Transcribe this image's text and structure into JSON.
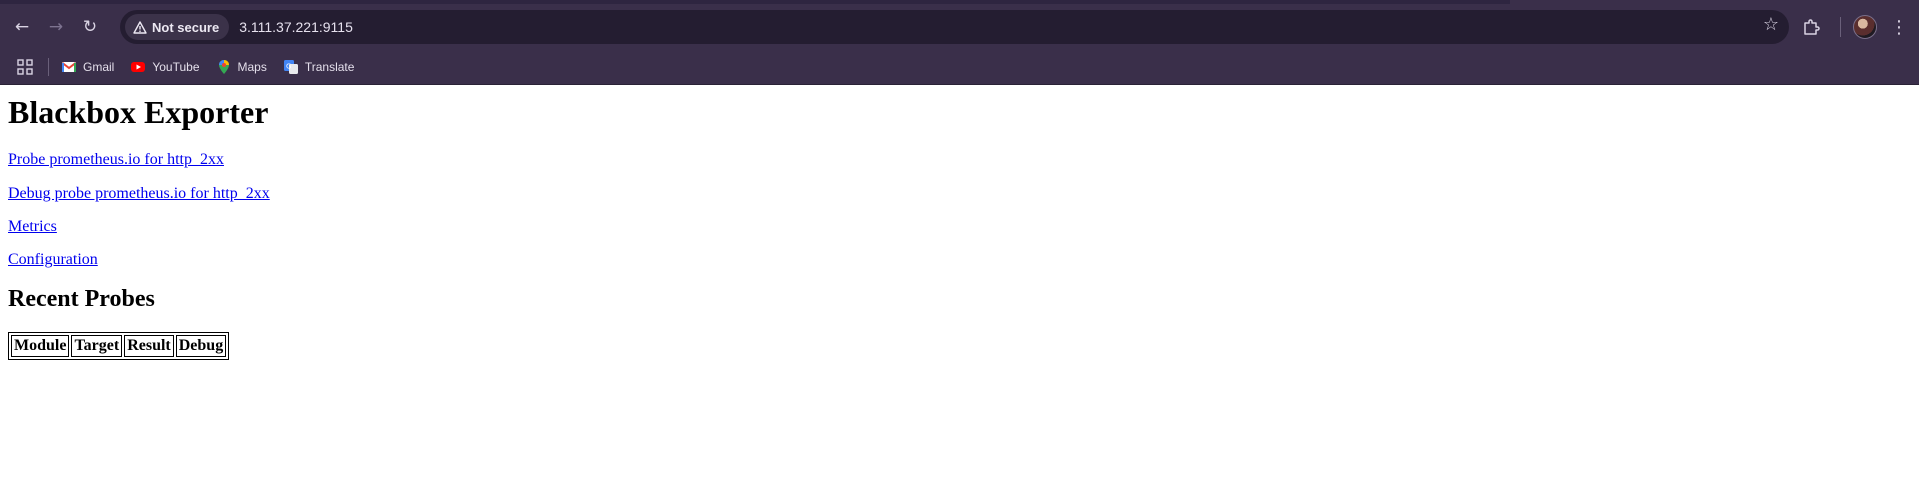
{
  "browser": {
    "url": "3.111.37.221:9115",
    "security_label": "Not secure",
    "bookmarks": [
      {
        "label": "Gmail",
        "icon": "gmail-icon"
      },
      {
        "label": "YouTube",
        "icon": "youtube-icon"
      },
      {
        "label": "Maps",
        "icon": "maps-icon"
      },
      {
        "label": "Translate",
        "icon": "translate-icon"
      }
    ]
  },
  "page": {
    "title": "Blackbox Exporter",
    "links": [
      "Probe prometheus.io for http_2xx",
      "Debug probe prometheus.io for http_2xx",
      "Metrics",
      "Configuration"
    ],
    "recent_heading": "Recent Probes",
    "table_headers": [
      "Module",
      "Target",
      "Result",
      "Debug"
    ]
  },
  "colors": {
    "chrome_bg": "#3a2f4a",
    "omnibox_bg": "#241d31",
    "link": "#0000ee"
  }
}
